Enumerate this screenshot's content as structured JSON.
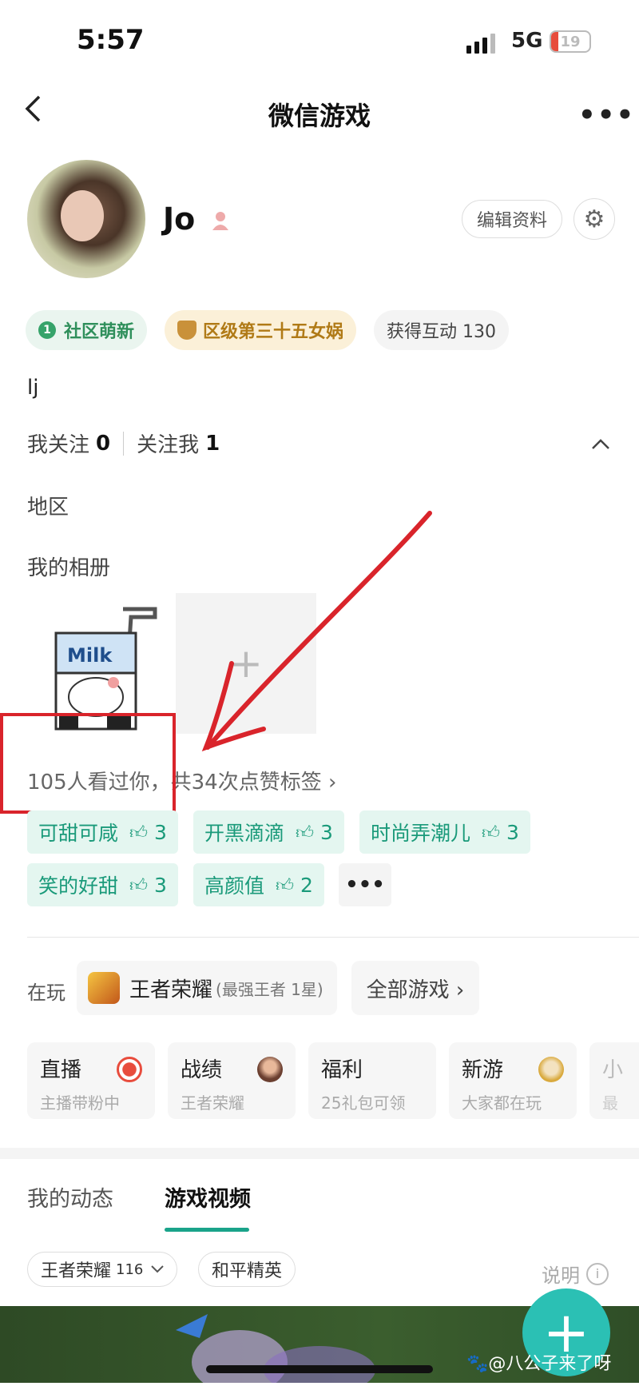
{
  "status_bar": {
    "time": "5:57",
    "network": "5G",
    "battery": "19",
    "battery_level": 0.19
  },
  "nav": {
    "title": "微信游戏",
    "back_icon": "chevron-left-icon",
    "more_label": "•••"
  },
  "profile": {
    "name": "Jo",
    "edit_label": "编辑资料",
    "tags": {
      "community": "社区萌新",
      "community_num": "1",
      "rank": "区级第三十五女娲",
      "interactions": "获得互动 130"
    },
    "bio": "lj",
    "following_label": "我关注",
    "following_count": "0",
    "followers_label": "关注我",
    "followers_count": "1",
    "region_label": "地区",
    "album_label": "我的相册",
    "album_add": "+",
    "visitors_text": "105人看过你，共34次点赞标签 ›"
  },
  "like_tags": [
    {
      "label": "可甜可咸",
      "count": "3"
    },
    {
      "label": "开黑滴滴",
      "count": "3"
    },
    {
      "label": "时尚弄潮儿",
      "count": "3"
    },
    {
      "label": "笑的好甜",
      "count": "3"
    },
    {
      "label": "高颜值",
      "count": "2"
    }
  ],
  "like_more": "•••",
  "playing": {
    "label": "在玩",
    "game": "王者荣耀",
    "rank": "(最强王者 1星)",
    "all_games": "全部游戏 ›"
  },
  "features": [
    {
      "title": "直播",
      "sub": "主播带粉中",
      "color": "#e84c3d"
    },
    {
      "title": "战绩",
      "sub": "王者荣耀",
      "color": "#8a5a4a"
    },
    {
      "title": "福利",
      "sub": "25礼包可领",
      "color": ""
    },
    {
      "title": "新游",
      "sub": "大家都在玩",
      "color": "#e8c25a"
    },
    {
      "title": "小",
      "sub": "最",
      "color": ""
    }
  ],
  "tabs": {
    "mine": "我的动态",
    "videos": "游戏视频"
  },
  "chips": {
    "game1": "王者荣耀",
    "game1_count": "116",
    "game2": "和平精英"
  },
  "explain_label": "说明",
  "fab_label": "+",
  "watermark": "🐾@八公子来了呀",
  "colors": {
    "accent": "#1aa38a",
    "annotation": "#d9242b",
    "tag_bg": "#e4f6f0"
  }
}
